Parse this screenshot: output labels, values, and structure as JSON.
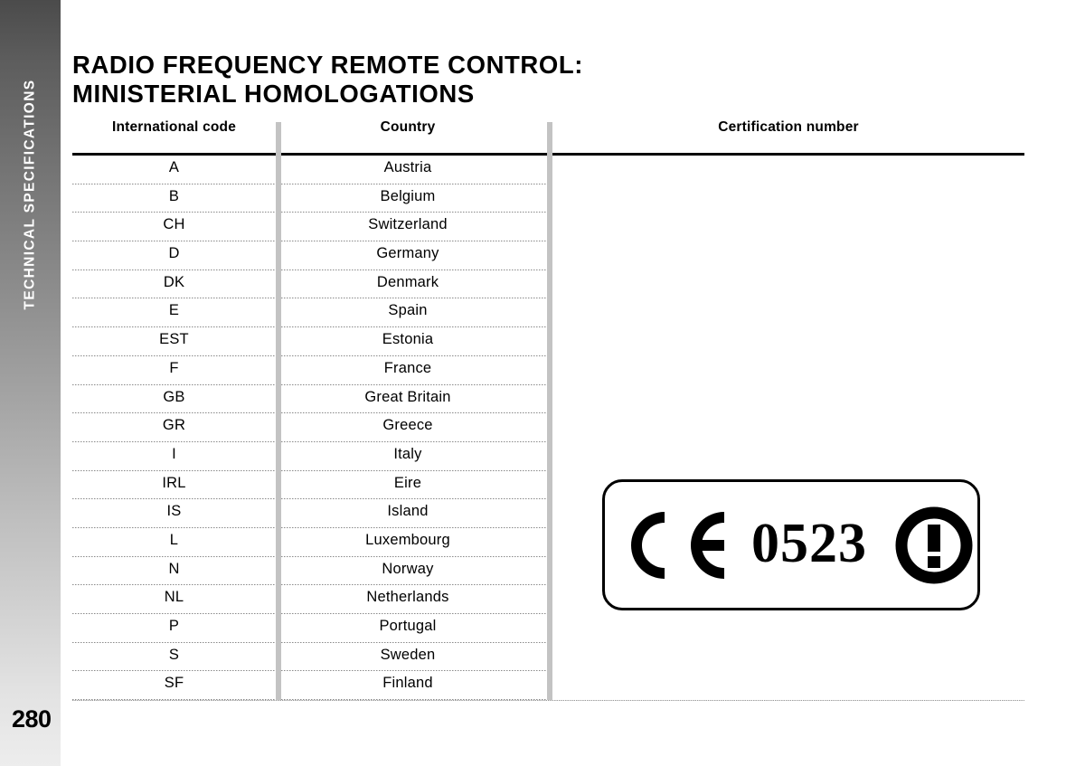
{
  "sidebar": {
    "section_label": "TECHNICAL SPECIFICATIONS",
    "page_number": "280"
  },
  "title": {
    "line1": "RADIO FREQUENCY REMOTE CONTROL:",
    "line2": "MINISTERIAL HOMOLOGATIONS"
  },
  "table": {
    "headers": {
      "code": "International code",
      "country": "Country",
      "certification": "Certification number"
    },
    "rows": [
      {
        "code": "A",
        "country": "Austria"
      },
      {
        "code": "B",
        "country": "Belgium"
      },
      {
        "code": "CH",
        "country": "Switzerland"
      },
      {
        "code": "D",
        "country": "Germany"
      },
      {
        "code": "DK",
        "country": "Denmark"
      },
      {
        "code": "E",
        "country": "Spain"
      },
      {
        "code": "EST",
        "country": "Estonia"
      },
      {
        "code": "F",
        "country": "France"
      },
      {
        "code": "GB",
        "country": "Great Britain"
      },
      {
        "code": "GR",
        "country": "Greece"
      },
      {
        "code": "I",
        "country": "Italy"
      },
      {
        "code": "IRL",
        "country": "Eire"
      },
      {
        "code": "IS",
        "country": "Island"
      },
      {
        "code": "L",
        "country": "Luxembourg"
      },
      {
        "code": "N",
        "country": "Norway"
      },
      {
        "code": "NL",
        "country": "Netherlands"
      },
      {
        "code": "P",
        "country": "Portugal"
      },
      {
        "code": "S",
        "country": "Sweden"
      },
      {
        "code": "SF",
        "country": "Finland"
      }
    ]
  },
  "certification_badge": {
    "ce_mark": "ce-mark-icon",
    "notified_body_number": "0523",
    "alert_symbol": "alert-exclamation-circle-icon"
  },
  "colors": {
    "ink": "#000000",
    "paper": "#ffffff",
    "separator_gray": "#c3c3c3",
    "dotted_gray": "#8a8a8a",
    "sidebar_top": "#4b4b4b",
    "sidebar_bottom": "#ededed"
  }
}
